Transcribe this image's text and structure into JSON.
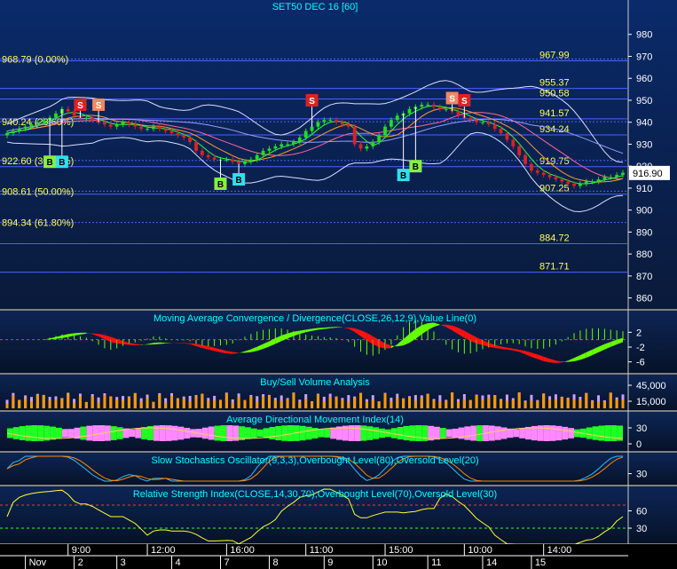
{
  "colors": {
    "panel": "#0b1f45",
    "panel_dark": "#061226",
    "grid": "#3a4a8a",
    "axis_text": "#ffffff",
    "title_text": "#00ffff",
    "fib_text": "#ffff55",
    "fib_line": "#4a63ff",
    "bull": "#22dd22",
    "bear": "#dd2222",
    "up_fill": "#66ff00",
    "down_fill": "#ff1010",
    "vol_buy": "#ff9900",
    "vol_sell": "#c8a0ff",
    "adx_plus": "#22ff22",
    "adx_minus": "#ff88ff",
    "stoch_k": "#33bbff",
    "stoch_d": "#ff8800",
    "rsi": "#ffff33"
  },
  "chart_data": [
    {
      "type": "candlestick",
      "title": "SET50 DEC 16  [60]",
      "ylim": [
        855,
        990
      ],
      "yticks": [
        860,
        870,
        880,
        890,
        900,
        910,
        920,
        930,
        940,
        950,
        960,
        970,
        980
      ],
      "last_price": "916.90",
      "fib_levels": [
        {
          "value": 968.79,
          "label": "968.79 (0.00%)",
          "side": "left"
        },
        {
          "value": 940.24,
          "label": "940.24 (23.60%)",
          "side": "left"
        },
        {
          "value": 922.6,
          "label": "922.60 (38.20%)",
          "side": "left"
        },
        {
          "value": 908.61,
          "label": "908.61 (50.00%)",
          "side": "left"
        },
        {
          "value": 894.34,
          "label": "894.34 (61.80%)",
          "side": "left"
        }
      ],
      "levels": [
        {
          "value": 967.99,
          "label": "967.99"
        },
        {
          "value": 955.37,
          "label": "955.37"
        },
        {
          "value": 950.58,
          "label": "950.58"
        },
        {
          "value": 941.57,
          "label": "941.57"
        },
        {
          "value": 934.24,
          "label": "934.24"
        },
        {
          "value": 919.75,
          "label": "919.75"
        },
        {
          "value": 907.25,
          "label": "907.25"
        },
        {
          "value": 884.72,
          "label": "884.72"
        },
        {
          "value": 871.71,
          "label": "871.71"
        }
      ],
      "close": [
        935,
        936,
        937,
        938,
        939,
        940,
        941,
        942,
        944,
        946,
        945,
        943,
        942,
        942,
        941,
        940,
        939,
        938,
        939,
        940,
        939,
        938,
        937,
        937,
        938,
        937,
        936,
        935,
        934,
        933,
        931,
        927,
        925,
        924,
        923,
        923,
        923,
        922,
        921,
        922,
        923,
        925,
        927,
        928,
        929,
        930,
        930,
        931,
        933,
        936,
        938,
        940,
        941,
        941,
        940,
        939,
        938,
        930,
        928,
        929,
        931,
        934,
        938,
        941,
        943,
        944,
        946,
        947,
        948,
        948,
        947,
        946,
        946,
        945,
        943,
        942,
        941,
        940,
        940,
        939,
        937,
        935,
        932,
        929,
        925,
        921,
        918,
        917,
        916,
        915,
        914,
        913,
        912,
        911,
        912,
        913,
        913,
        914,
        915,
        915,
        916,
        917
      ],
      "signals": [
        {
          "i": 12,
          "type": "S",
          "value": 948
        },
        {
          "i": 15,
          "type": "S",
          "value": 948
        },
        {
          "i": 35,
          "type": "B",
          "value": 912
        },
        {
          "i": 38,
          "type": "B",
          "value": 914
        },
        {
          "i": 7,
          "type": "B",
          "value": 922
        },
        {
          "i": 9,
          "type": "B",
          "value": 922
        },
        {
          "i": 50,
          "type": "S",
          "value": 950
        },
        {
          "i": 65,
          "type": "B",
          "value": 916
        },
        {
          "i": 67,
          "type": "B",
          "value": 920
        },
        {
          "i": 73,
          "type": "S",
          "value": 951
        },
        {
          "i": 75,
          "type": "S",
          "value": 950
        }
      ]
    },
    {
      "type": "area",
      "title": "Moving Average Convergence / Divergence(CLOSE,26,12,9),Value Line(0)",
      "yticks": [
        2,
        -2,
        -6
      ],
      "ylim": [
        -8,
        4
      ]
    },
    {
      "type": "bar",
      "title": "Buy/Sell Volume Analysis",
      "yticks": [
        "45,000",
        "15,000"
      ]
    },
    {
      "type": "area",
      "title": "Average Directional Movement Index(14)",
      "yticks": [
        30,
        0
      ]
    },
    {
      "type": "line",
      "title": "Slow Stochastics Oscillator(9,3,3),Overbought Level(80),Oversold Level(20)",
      "yticks": [
        30
      ]
    },
    {
      "type": "line",
      "title": "Relative Strength Index(CLOSE,14,30,70),Overbought Level(70),Oversold Level(30)",
      "yticks": [
        60,
        30
      ]
    }
  ],
  "time_labels": [
    {
      "i": 10,
      "label": "9:00"
    },
    {
      "i": 23,
      "label": "12:00"
    },
    {
      "i": 36,
      "label": "16:00"
    },
    {
      "i": 49,
      "label": "11:00"
    },
    {
      "i": 62,
      "label": "15:00"
    },
    {
      "i": 75,
      "label": "10:00"
    },
    {
      "i": 88,
      "label": "14:00"
    }
  ],
  "date_labels": [
    {
      "i": 3,
      "label": "Nov"
    },
    {
      "i": 11,
      "label": "2"
    },
    {
      "i": 18,
      "label": "3"
    },
    {
      "i": 27,
      "label": "4"
    },
    {
      "i": 35,
      "label": "7"
    },
    {
      "i": 43,
      "label": "8"
    },
    {
      "i": 52,
      "label": "9"
    },
    {
      "i": 60,
      "label": "10"
    },
    {
      "i": 69,
      "label": "11"
    },
    {
      "i": 78,
      "label": "14"
    },
    {
      "i": 86,
      "label": "15"
    }
  ]
}
